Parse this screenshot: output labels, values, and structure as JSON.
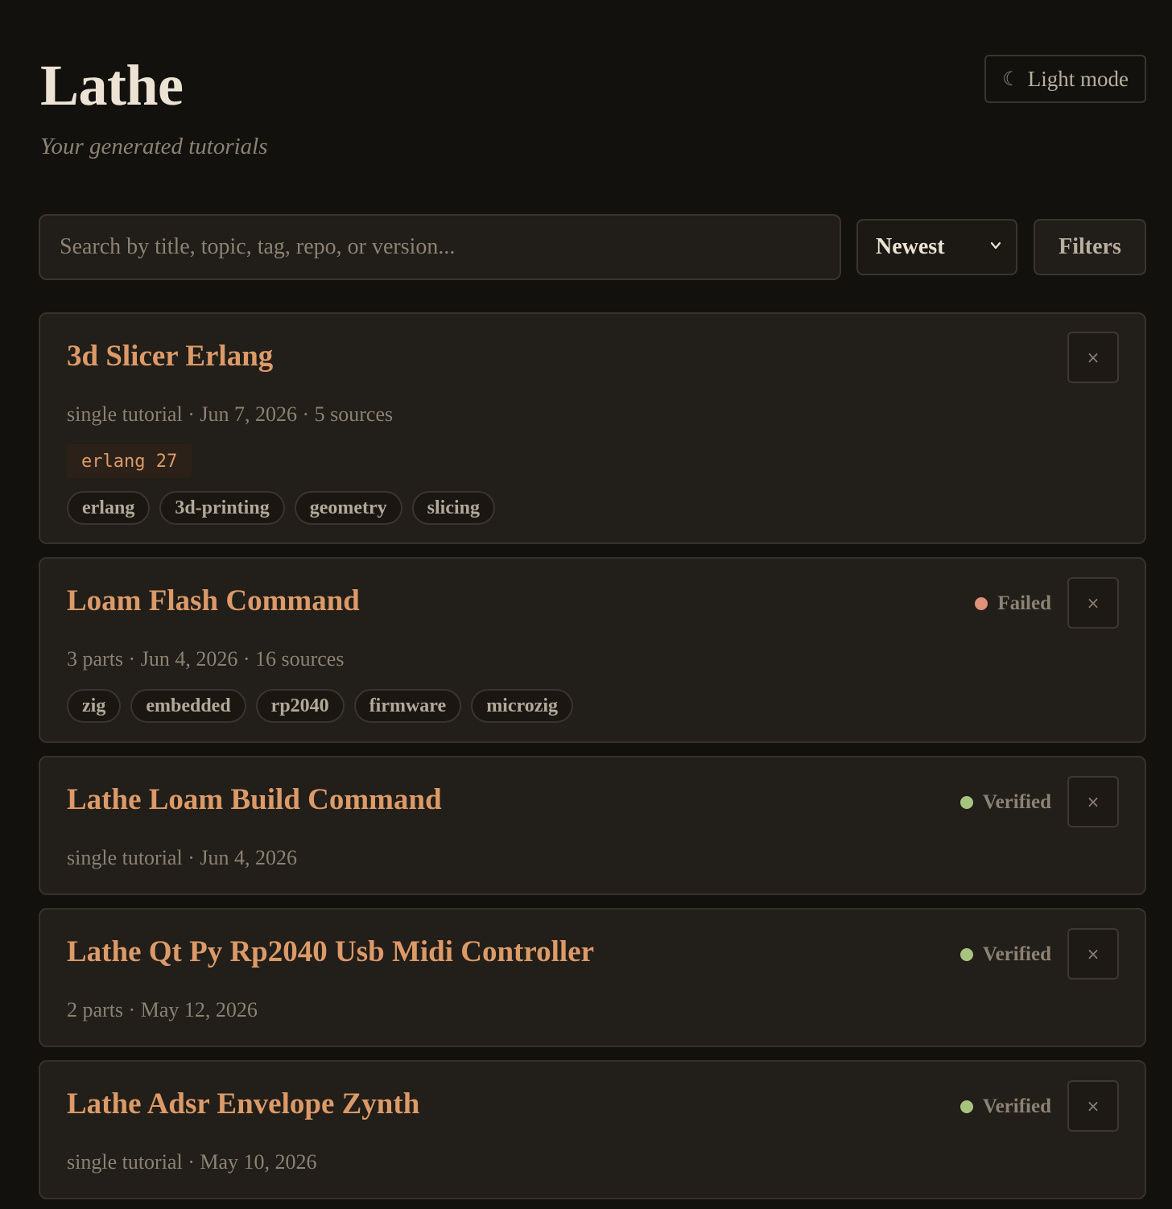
{
  "header": {
    "title": "Lathe",
    "subtitle": "Your generated tutorials",
    "theme_toggle_icon": "moon-icon",
    "theme_toggle_label": "Light mode"
  },
  "controls": {
    "search_placeholder": "Search by title, topic, tag, repo, or version...",
    "sort_selected": "Newest",
    "filters_label": "Filters"
  },
  "colors": {
    "accent": "#dc9a68",
    "status_failed": "#e0917a",
    "status_verified": "#a7c47f"
  },
  "tutorials": [
    {
      "title": "3d Slicer Erlang",
      "meta": "single tutorial · Jun 7, 2026 · 5 sources",
      "version": "erlang 27",
      "status": "",
      "tags": [
        "erlang",
        "3d-printing",
        "geometry",
        "slicing"
      ],
      "close": "×"
    },
    {
      "title": "Loam Flash Command",
      "meta": "3 parts · Jun 4, 2026 · 16 sources",
      "status": "Failed",
      "tags": [
        "zig",
        "embedded",
        "rp2040",
        "firmware",
        "microzig"
      ],
      "close": "×"
    },
    {
      "title": "Lathe Loam Build Command",
      "meta": "single tutorial · Jun 4, 2026",
      "status": "Verified",
      "tags": [],
      "close": "×"
    },
    {
      "title": "Lathe Qt Py Rp2040 Usb Midi Controller",
      "meta": "2 parts · May 12, 2026",
      "status": "Verified",
      "tags": [],
      "close": "×"
    },
    {
      "title": "Lathe Adsr Envelope Zynth",
      "meta": "single tutorial · May 10, 2026",
      "status": "Verified",
      "tags": [],
      "close": "×"
    }
  ]
}
